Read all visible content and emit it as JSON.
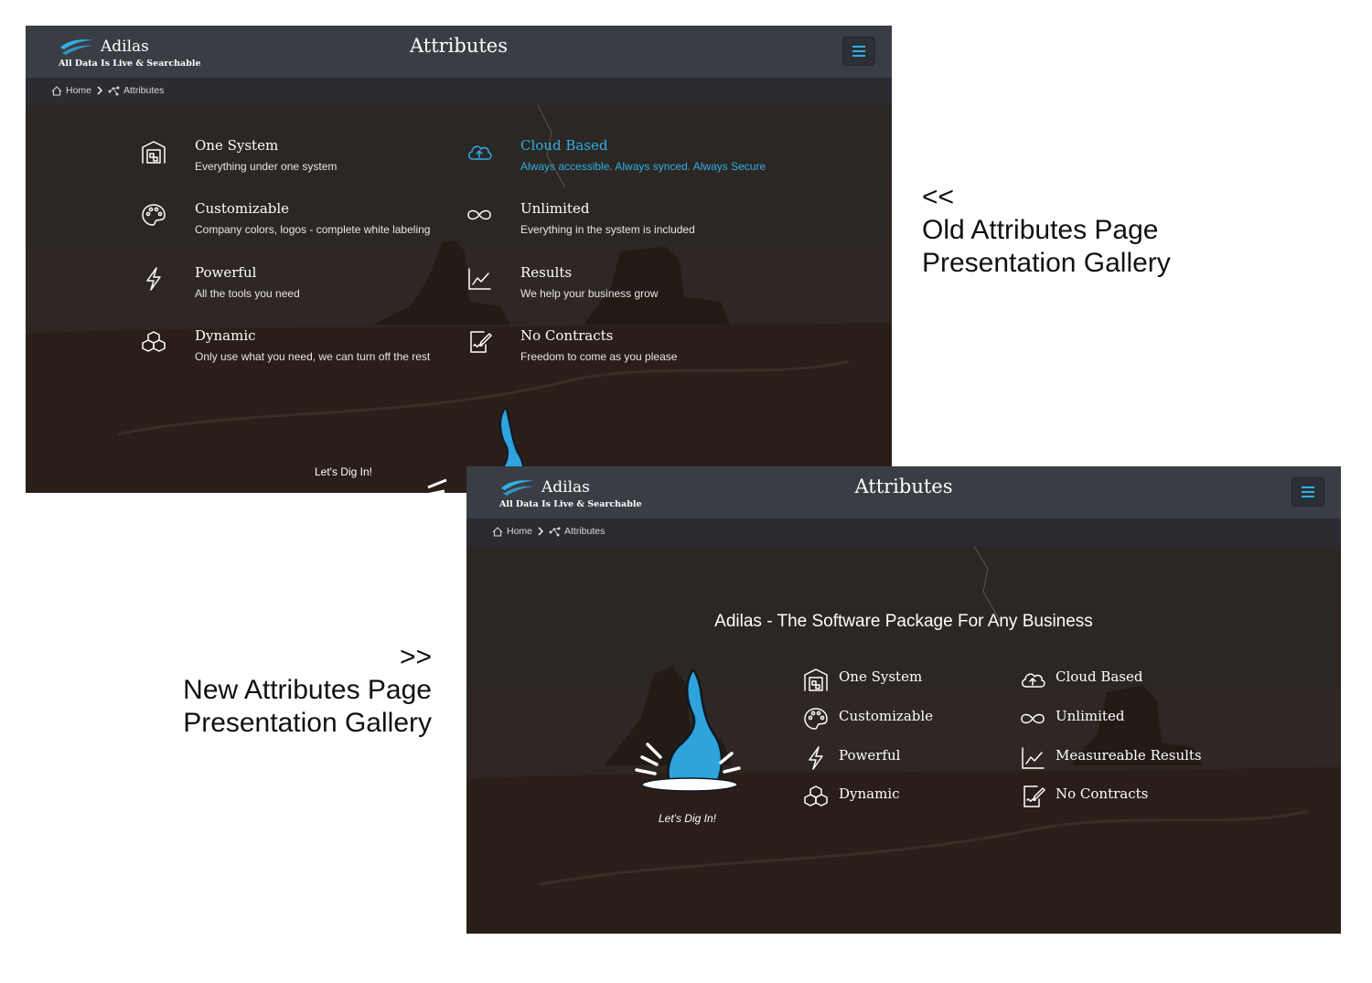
{
  "header": {
    "brand_name": "Adilas",
    "brand_tagline": "All Data Is Live & Searchable",
    "page_title": "Attributes",
    "menu_icon": "hamburger-icon"
  },
  "breadcrumb": {
    "home_label": "Home",
    "current_label": "Attributes"
  },
  "colors": {
    "accent": "#2fb0e6",
    "topbar": "#3a3d44",
    "crumbbar": "#2a2c31"
  },
  "old_page": {
    "features": [
      {
        "icon": "building-icon",
        "title": "One System",
        "desc": "Everything under one system",
        "active": false
      },
      {
        "icon": "cloud-upload-icon",
        "title": "Cloud Based",
        "desc": "Always accessible. Always synced. Always Secure",
        "active": true
      },
      {
        "icon": "palette-icon",
        "title": "Customizable",
        "desc": "Company colors, logos - complete white labeling",
        "active": false
      },
      {
        "icon": "infinity-icon",
        "title": "Unlimited",
        "desc": "Everything in the system is included",
        "active": false
      },
      {
        "icon": "lightning-icon",
        "title": "Powerful",
        "desc": "All the tools you need",
        "active": false
      },
      {
        "icon": "line-chart-icon",
        "title": "Results",
        "desc": "We help your business grow",
        "active": false
      },
      {
        "icon": "cubes-icon",
        "title": "Dynamic",
        "desc": "Only use what you need, we can turn off the rest",
        "active": false
      },
      {
        "icon": "signed-document-icon",
        "title": "No Contracts",
        "desc": "Freedom to come as you please",
        "active": false
      }
    ],
    "dig_label": "Let's Dig In!"
  },
  "new_page": {
    "headline": "Adilas - The Software Package For Any Business",
    "features": [
      {
        "icon": "building-icon",
        "title": "One System"
      },
      {
        "icon": "cloud-upload-icon",
        "title": "Cloud Based"
      },
      {
        "icon": "palette-icon",
        "title": "Customizable"
      },
      {
        "icon": "infinity-icon",
        "title": "Unlimited"
      },
      {
        "icon": "lightning-icon",
        "title": "Powerful"
      },
      {
        "icon": "line-chart-icon",
        "title": "Measureable Results"
      },
      {
        "icon": "cubes-icon",
        "title": "Dynamic"
      },
      {
        "icon": "signed-document-icon",
        "title": "No Contracts"
      }
    ],
    "dig_label": "Let's Dig In!"
  },
  "captions": {
    "old_arrow": "<<",
    "old_line1": "Old Attributes Page",
    "old_line2": "Presentation Gallery",
    "new_arrow": ">>",
    "new_line1": "New Attributes Page",
    "new_line2": "Presentation Gallery"
  }
}
